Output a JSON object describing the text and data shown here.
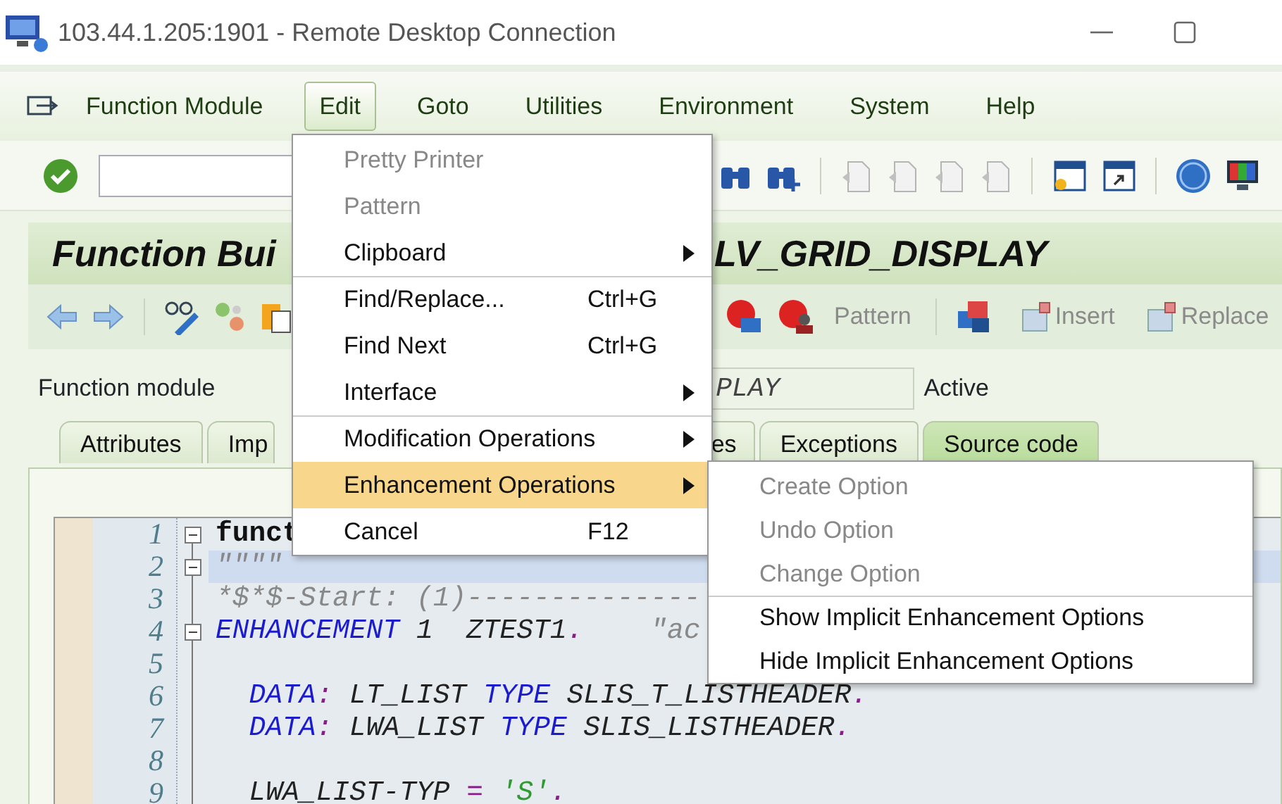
{
  "window": {
    "title": "103.44.1.205:1901 - Remote Desktop Connection"
  },
  "menu_bar": [
    {
      "label": "Function Module",
      "selected": false
    },
    {
      "label": "Edit",
      "selected": true
    },
    {
      "label": "Goto",
      "selected": false
    },
    {
      "label": "Utilities",
      "selected": false
    },
    {
      "label": "Environment",
      "selected": false
    },
    {
      "label": "System",
      "selected": false
    },
    {
      "label": "Help",
      "selected": false
    }
  ],
  "screen_title": {
    "left": "Function Bui",
    "right": "LV_GRID_DISPLAY"
  },
  "app_toolbar": {
    "buttons": [
      {
        "label": "Pattern",
        "kind": "text",
        "disabled": true
      },
      {
        "label": "Insert",
        "kind": "insert",
        "disabled": true
      },
      {
        "label": "Replace",
        "kind": "replace",
        "disabled": true
      }
    ]
  },
  "header": {
    "label": "Function module",
    "value": "PLAY",
    "status": "Active"
  },
  "tabs": [
    {
      "label": "Attributes",
      "selected": false
    },
    {
      "label": "Imp",
      "selected": false
    },
    {
      "label": "es",
      "selected": false
    },
    {
      "label": "Exceptions",
      "selected": false
    },
    {
      "label": "Source code",
      "selected": true
    }
  ],
  "editor": {
    "lines": [
      {
        "number": "1",
        "collapsible": true,
        "current": false,
        "segments": [
          {
            "text": "funct",
            "kind": "statement"
          }
        ]
      },
      {
        "number": "2",
        "collapsible": true,
        "current": true,
        "segments": [
          {
            "text": "\"\"\"\"",
            "kind": "comment"
          }
        ]
      },
      {
        "number": "3",
        "collapsible": false,
        "current": false,
        "segments": [
          {
            "text": "*$*$-Start: (1)--------------",
            "kind": "comment"
          }
        ]
      },
      {
        "number": "4",
        "collapsible": true,
        "current": false,
        "segments": [
          {
            "text": "ENHANCEMENT",
            "kind": "keyword"
          },
          {
            "text": " 1  ZTEST1",
            "kind": "plain"
          },
          {
            "text": ".",
            "kind": "punct"
          },
          {
            "text": "    \"ac",
            "kind": "comment"
          }
        ]
      },
      {
        "number": "5",
        "collapsible": false,
        "current": false
      },
      {
        "number": "6",
        "collapsible": false,
        "current": false,
        "segments": [
          {
            "text": "  DATA",
            "kind": "keyword"
          },
          {
            "text": ":",
            "kind": "punct"
          },
          {
            "text": " LT_LIST ",
            "kind": "plain"
          },
          {
            "text": "TYPE",
            "kind": "keyword"
          },
          {
            "text": " SLIS_T_LISTHEADER",
            "kind": "plain"
          },
          {
            "text": ".",
            "kind": "punct"
          }
        ]
      },
      {
        "number": "7",
        "collapsible": false,
        "current": false,
        "segments": [
          {
            "text": "  DATA",
            "kind": "keyword"
          },
          {
            "text": ":",
            "kind": "punct"
          },
          {
            "text": " LWA_LIST ",
            "kind": "plain"
          },
          {
            "text": "TYPE",
            "kind": "keyword"
          },
          {
            "text": " SLIS_LISTHEADER",
            "kind": "plain"
          },
          {
            "text": ".",
            "kind": "punct"
          }
        ]
      },
      {
        "number": "8",
        "collapsible": false,
        "current": false
      },
      {
        "number": "9",
        "collapsible": false,
        "current": false,
        "segments": [
          {
            "text": "  LWA_LIST-TYP ",
            "kind": "plain"
          },
          {
            "text": "= ",
            "kind": "punct"
          },
          {
            "text": "'S'",
            "kind": "string"
          },
          {
            "text": ".",
            "kind": "punct"
          }
        ]
      }
    ]
  },
  "edit_menu": {
    "items": [
      {
        "label": "Pretty Printer",
        "disabled": true,
        "submenu": false,
        "separator_before": false,
        "selected": false
      },
      {
        "label": "Pattern",
        "disabled": true,
        "submenu": false,
        "separator_before": false,
        "selected": false
      },
      {
        "label": "Clipboard",
        "disabled": false,
        "submenu": true,
        "separator_before": false,
        "selected": false
      },
      {
        "label": "Find/Replace...",
        "shortcut": "Ctrl+G",
        "disabled": false,
        "submenu": false,
        "separator_before": true,
        "selected": false
      },
      {
        "label": "Find Next",
        "shortcut": "Ctrl+G",
        "disabled": false,
        "submenu": false,
        "separator_before": false,
        "selected": false
      },
      {
        "label": "Interface",
        "disabled": false,
        "submenu": true,
        "separator_before": false,
        "selected": false
      },
      {
        "label": "Modification Operations",
        "disabled": false,
        "submenu": true,
        "separator_before": true,
        "selected": false
      },
      {
        "label": "Enhancement Operations",
        "disabled": false,
        "submenu": true,
        "separator_before": false,
        "selected": true
      },
      {
        "label": "Cancel",
        "shortcut": "F12",
        "disabled": false,
        "submenu": false,
        "separator_before": false,
        "selected": false
      }
    ]
  },
  "submenu": {
    "items": [
      {
        "label": "Create Option",
        "disabled": true,
        "separator_before": false
      },
      {
        "label": "Undo Option",
        "disabled": true,
        "separator_before": false
      },
      {
        "label": "Change Option",
        "disabled": true,
        "separator_before": false
      },
      {
        "label": "Show Implicit Enhancement Options",
        "disabled": false,
        "separator_before": true
      },
      {
        "label": "Hide Implicit Enhancement Options",
        "disabled": false,
        "separator_before": false
      }
    ]
  }
}
